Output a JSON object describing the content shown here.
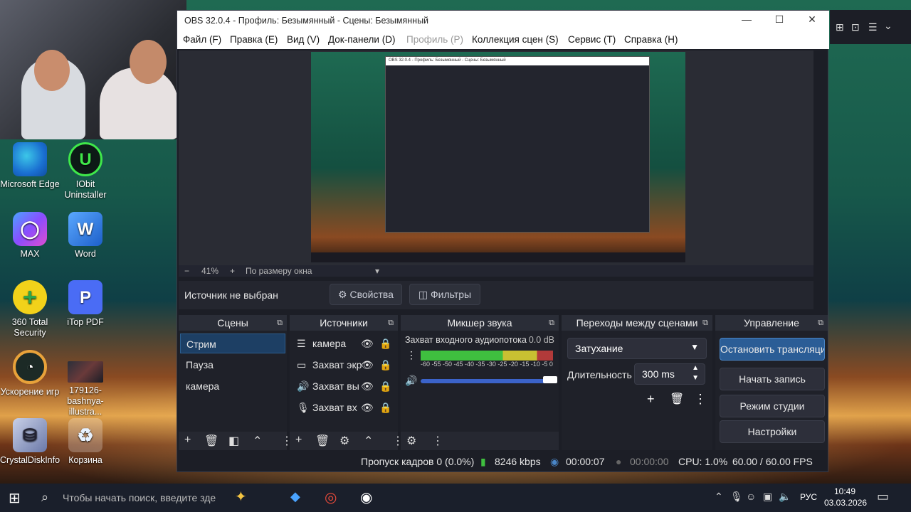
{
  "window": {
    "title": "OBS 32.0.4 - Профиль: Безымянный - Сцены: Безымянный",
    "minimize": "—",
    "maximize": "☐",
    "close": "✕"
  },
  "menu": [
    "Файл (F)",
    "Правка (E)",
    "Вид (V)",
    "Док-панели (D)",
    "Профиль (P)",
    "Коллекция сцен (S)",
    "Сервис (T)",
    "Справка (H)"
  ],
  "zoom": {
    "minus": "−",
    "percent": "41%",
    "plus": "+",
    "fit": "По размеру окна"
  },
  "source_bar": {
    "label": "Источник не выбран",
    "properties": "Свойства",
    "filters": "Фильтры"
  },
  "docks": {
    "scenes": {
      "title": "Сцены",
      "items": [
        "Стрим",
        "Пауза",
        "камера"
      ]
    },
    "sources": {
      "title": "Источники",
      "items": [
        "камера",
        "Захват экр",
        "Захват вы",
        "Захват вх"
      ]
    },
    "mixer": {
      "title": "Микшер звука",
      "channel": "Захват входного аудиопотока",
      "level": "0.0 dB",
      "scale": [
        "-60",
        "-55",
        "-50",
        "-45",
        "-40",
        "-35",
        "-30",
        "-25",
        "-20",
        "-15",
        "-10",
        "-5",
        "0"
      ]
    },
    "transitions": {
      "title": "Переходы между сценами",
      "selected": "Затухание",
      "duration_label": "Длительность",
      "duration_value": "300 ms"
    },
    "controls": {
      "title": "Управление",
      "buttons": [
        "Остановить трансляцию",
        "Начать запись",
        "Режим студии",
        "Настройки"
      ]
    }
  },
  "status": {
    "dropped": "Пропуск кадров 0 (0.0%)",
    "bitrate": "8246 kbps",
    "stream_time": "00:00:07",
    "rec_time": "00:00:00",
    "cpu": "CPU: 1.0%",
    "fps": "60.00 / 60.00 FPS"
  },
  "desktop_icons": [
    {
      "label": "Microsoft Edge",
      "icon": "edge-icon"
    },
    {
      "label": "IObit Uninstaller",
      "icon": "iobit-icon"
    },
    {
      "label": "MAX",
      "icon": "max-icon"
    },
    {
      "label": "Word",
      "icon": "word-icon"
    },
    {
      "label": "360 Total Security",
      "icon": "360-icon"
    },
    {
      "label": "iTop PDF",
      "icon": "itop-icon"
    },
    {
      "label": "Ускорение игр",
      "icon": "gauge-icon"
    },
    {
      "label": "179126-bashnya-illustra...",
      "icon": "image-file-icon"
    },
    {
      "label": "CrystalDiskInfo",
      "icon": "disk-icon"
    },
    {
      "label": "Корзина",
      "icon": "recycle-bin-icon"
    }
  ],
  "taskbar": {
    "search_placeholder": "Чтобы начать поиск, введите зде",
    "lang": "РУС",
    "time": "10:49",
    "date": "03.03.2026"
  },
  "colors": {
    "accent": "#2b5d96",
    "meter_green": "#3fbf3f",
    "meter_yellow": "#c8c032"
  }
}
